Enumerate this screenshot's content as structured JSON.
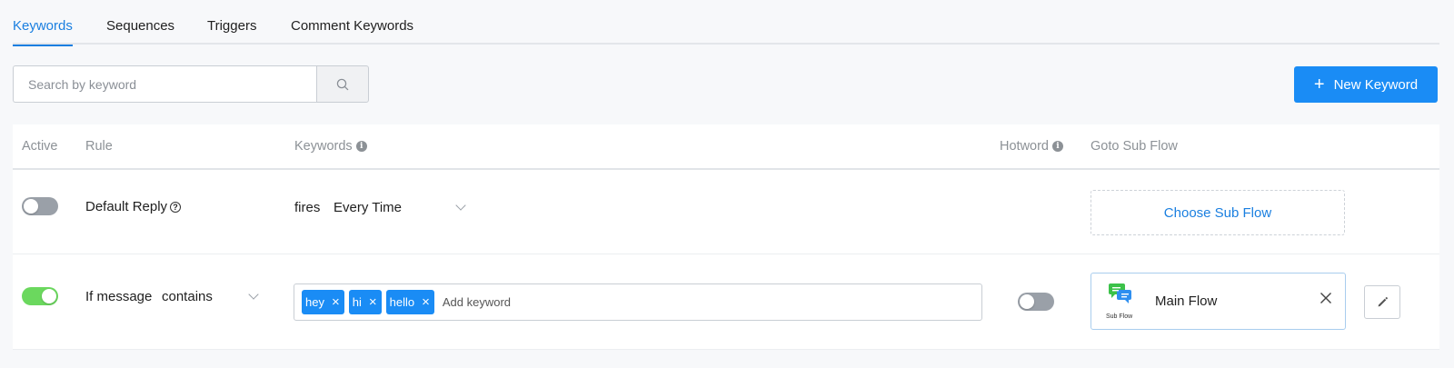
{
  "tabs": [
    {
      "label": "Keywords",
      "active": true
    },
    {
      "label": "Sequences",
      "active": false
    },
    {
      "label": "Triggers",
      "active": false
    },
    {
      "label": "Comment Keywords",
      "active": false
    }
  ],
  "search": {
    "placeholder": "Search by keyword",
    "value": ""
  },
  "new_keyword_button": {
    "label": "New Keyword"
  },
  "table": {
    "headers": {
      "active": "Active",
      "rule": "Rule",
      "keywords": "Keywords",
      "hotword": "Hotword",
      "goto_sub_flow": "Goto Sub Flow"
    },
    "rows": [
      {
        "active": false,
        "rule_label": "Default Reply",
        "fires_label": "fires",
        "fires_value": "Every Time",
        "sub_flow_placeholder": "Choose Sub Flow"
      },
      {
        "active": true,
        "rule_prefix": "If message",
        "rule_condition": "contains",
        "keywords": [
          "hey",
          "hi",
          "hello"
        ],
        "keyword_placeholder": "Add keyword",
        "hotword": false,
        "sub_flow_caption": "Sub Flow",
        "sub_flow_name": "Main Flow"
      }
    ]
  },
  "colors": {
    "accent": "#1a8cf5",
    "toggle_on": "#6bd85e",
    "toggle_off": "#9aa0a8"
  }
}
